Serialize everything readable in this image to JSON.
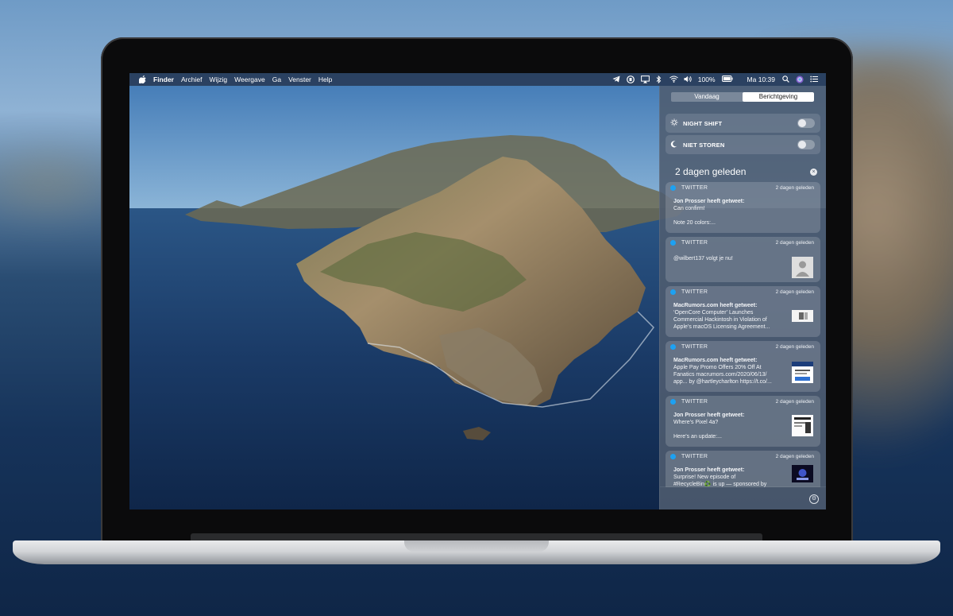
{
  "menubar": {
    "apple": "",
    "app": "Finder",
    "menus": [
      "Archief",
      "Wijzig",
      "Weergave",
      "Ga",
      "Venster",
      "Help"
    ],
    "battery": "100%",
    "clock": "Ma 10:39"
  },
  "notification_center": {
    "tabs": {
      "today": "Vandaag",
      "notifications": "Berichtgeving"
    },
    "toggles": [
      {
        "label": "NIGHT SHIFT",
        "on": false
      },
      {
        "label": "NIET STOREN",
        "on": false
      }
    ],
    "group_title": "2 dagen geleden",
    "notifications": [
      {
        "app": "TWITTER",
        "time": "2 dagen geleden",
        "who": "Jon Prosser heeft getweet:",
        "lines": [
          "Can confirm!",
          "",
          "Note 20 colors:..."
        ],
        "thumb": ""
      },
      {
        "app": "TWITTER",
        "time": "2 dagen geleden",
        "who": "",
        "lines": [
          "@wilbert137 volgt je nu!"
        ],
        "thumb": "avatar"
      },
      {
        "app": "TWITTER",
        "time": "2 dagen geleden",
        "who": "MacRumors.com heeft getweet:",
        "lines": [
          "‘OpenCore Computer’ Launches",
          "Commercial Hackintosh in Violation of",
          "Apple’s macOS Licensing Agreement..."
        ],
        "thumb": "image"
      },
      {
        "app": "TWITTER",
        "time": "2 dagen geleden",
        "who": "MacRumors.com heeft getweet:",
        "lines": [
          "Apple Pay Promo Offers 20% Off At",
          "Fanatics macrumors.com/2020/06/13/",
          "app... by @hartleycharlton https://t.co/..."
        ],
        "thumb": "image"
      },
      {
        "app": "TWITTER",
        "time": "2 dagen geleden",
        "who": "Jon Prosser heeft getweet:",
        "lines": [
          "Where’s Pixel 4a?",
          "",
          "Here’s an update:..."
        ],
        "thumb": "image"
      },
      {
        "app": "TWITTER",
        "time": "2 dagen geleden",
        "who": "Jon Prosser heeft getweet:",
        "lines": [
          "Surprise! New episode of",
          "#RecycleBin♻️ is up — sponsored by"
        ],
        "thumb": "image"
      }
    ]
  }
}
